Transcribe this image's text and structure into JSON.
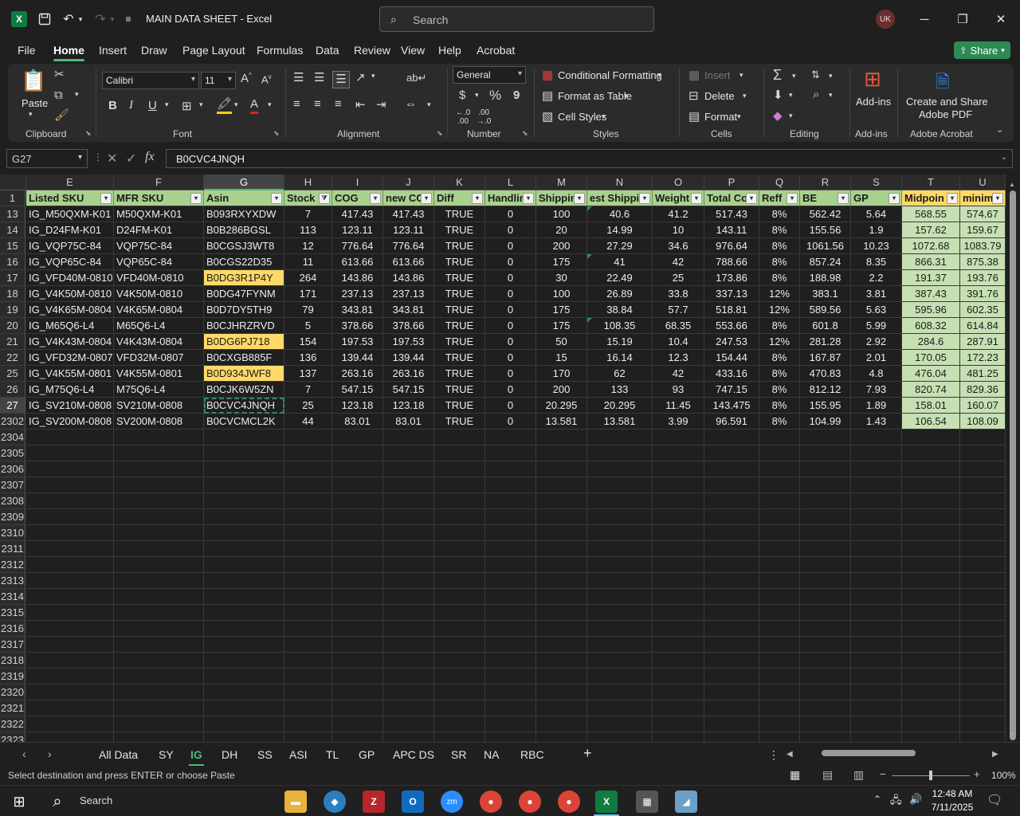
{
  "window": {
    "title": "MAIN DATA SHEET  -  Excel",
    "search_placeholder": "Search",
    "avatar_initials": "UK"
  },
  "ribbon_tabs": [
    "File",
    "Home",
    "Insert",
    "Draw",
    "Page Layout",
    "Formulas",
    "Data",
    "Review",
    "View",
    "Help",
    "Acrobat"
  ],
  "active_ribbon_tab": "Home",
  "share_label": "Share",
  "ribbon": {
    "clipboard": {
      "label": "Clipboard",
      "paste": "Paste"
    },
    "font": {
      "label": "Font",
      "name": "Calibri",
      "size": "11",
      "bold": "B",
      "italic": "I",
      "underline": "U"
    },
    "alignment": {
      "label": "Alignment"
    },
    "number": {
      "label": "Number",
      "format": "General",
      "currency": "$",
      "percent": "%",
      "comma": "9"
    },
    "styles": {
      "label": "Styles",
      "conditional": "Conditional Formatting",
      "format_table": "Format as Table",
      "cell_styles": "Cell Styles"
    },
    "cells": {
      "label": "Cells",
      "insert": "Insert",
      "delete": "Delete",
      "format": "Format"
    },
    "editing": {
      "label": "Editing"
    },
    "addins": {
      "label": "Add-ins",
      "button": "Add-ins"
    },
    "acrobat": {
      "label": "Adobe Acrobat",
      "button_line1": "Create and Share",
      "button_line2": "Adobe PDF"
    }
  },
  "formula_bar": {
    "name_box": "G27",
    "fx": "fx",
    "value": "B0CVC4JNQH"
  },
  "grid": {
    "columns": [
      "E",
      "F",
      "G",
      "H",
      "I",
      "J",
      "K",
      "L",
      "M",
      "N",
      "O",
      "P",
      "Q",
      "R",
      "S",
      "T",
      "U"
    ],
    "selected_column": "G",
    "headers": [
      "Listed SKU",
      "MFR SKU",
      "Asin",
      "Stock",
      "COG",
      "new CC",
      "Diff",
      "Handlin",
      "Shippin",
      "est Shippi",
      "Weight",
      "Total Co",
      "Reff",
      "BE",
      "GP",
      "Midpoin",
      "minimu"
    ],
    "rows": [
      {
        "n": "13",
        "cells": [
          "IG_M50QXM-K01",
          "M50QXM-K01",
          "B093RXYXDW",
          "7",
          "417.43",
          "417.43",
          "TRUE",
          "0",
          "100",
          "40.6",
          "41.2",
          "517.43",
          "8%",
          "562.42",
          "5.64",
          "568.55",
          "574.67"
        ],
        "asin_hl": false
      },
      {
        "n": "14",
        "cells": [
          "IG_D24FM-K01",
          "D24FM-K01",
          "B0B286BGSL",
          "113",
          "123.11",
          "123.11",
          "TRUE",
          "0",
          "20",
          "14.99",
          "10",
          "143.11",
          "8%",
          "155.56",
          "1.9",
          "157.62",
          "159.67"
        ],
        "asin_hl": false
      },
      {
        "n": "15",
        "cells": [
          "IG_VQP75C-84",
          "VQP75C-84",
          "B0CGSJ3WT8",
          "12",
          "776.64",
          "776.64",
          "TRUE",
          "0",
          "200",
          "27.29",
          "34.6",
          "976.64",
          "8%",
          "1061.56",
          "10.23",
          "1072.68",
          "1083.79"
        ],
        "asin_hl": false
      },
      {
        "n": "16",
        "cells": [
          "IG_VQP65C-84",
          "VQP65C-84",
          "B0CGS22D35",
          "11",
          "613.66",
          "613.66",
          "TRUE",
          "0",
          "175",
          "41",
          "42",
          "788.66",
          "8%",
          "857.24",
          "8.35",
          "866.31",
          "875.38"
        ],
        "asin_hl": false
      },
      {
        "n": "17",
        "cells": [
          "IG_VFD40M-0810",
          "VFD40M-0810",
          "B0DG3R1P4Y",
          "264",
          "143.86",
          "143.86",
          "TRUE",
          "0",
          "30",
          "22.49",
          "25",
          "173.86",
          "8%",
          "188.98",
          "2.2",
          "191.37",
          "193.76"
        ],
        "asin_hl": true
      },
      {
        "n": "18",
        "cells": [
          "IG_V4K50M-0810",
          "V4K50M-0810",
          "B0DG47FYNM",
          "171",
          "237.13",
          "237.13",
          "TRUE",
          "0",
          "100",
          "26.89",
          "33.8",
          "337.13",
          "12%",
          "383.1",
          "3.81",
          "387.43",
          "391.76"
        ],
        "asin_hl": false
      },
      {
        "n": "19",
        "cells": [
          "IG_V4K65M-0804",
          "V4K65M-0804",
          "B0D7DY5TH9",
          "79",
          "343.81",
          "343.81",
          "TRUE",
          "0",
          "175",
          "38.84",
          "57.7",
          "518.81",
          "12%",
          "589.56",
          "5.63",
          "595.96",
          "602.35"
        ],
        "asin_hl": false
      },
      {
        "n": "20",
        "cells": [
          "IG_M65Q6-L4",
          "M65Q6-L4",
          "B0CJHRZRVD",
          "5",
          "378.66",
          "378.66",
          "TRUE",
          "0",
          "175",
          "108.35",
          "68.35",
          "553.66",
          "8%",
          "601.8",
          "5.99",
          "608.32",
          "614.84"
        ],
        "asin_hl": false
      },
      {
        "n": "21",
        "cells": [
          "IG_V4K43M-0804",
          "V4K43M-0804",
          "B0DG6PJ718",
          "154",
          "197.53",
          "197.53",
          "TRUE",
          "0",
          "50",
          "15.19",
          "10.4",
          "247.53",
          "12%",
          "281.28",
          "2.92",
          "284.6",
          "287.91"
        ],
        "asin_hl": true
      },
      {
        "n": "22",
        "cells": [
          "IG_VFD32M-0807",
          "VFD32M-0807",
          "B0CXGB885F",
          "136",
          "139.44",
          "139.44",
          "TRUE",
          "0",
          "15",
          "16.14",
          "12.3",
          "154.44",
          "8%",
          "167.87",
          "2.01",
          "170.05",
          "172.23"
        ],
        "asin_hl": false
      },
      {
        "n": "25",
        "cells": [
          "IG_V4K55M-0801",
          "V4K55M-0801",
          "B0D934JWF8",
          "137",
          "263.16",
          "263.16",
          "TRUE",
          "0",
          "170",
          "62",
          "42",
          "433.16",
          "8%",
          "470.83",
          "4.8",
          "476.04",
          "481.25"
        ],
        "asin_hl": true
      },
      {
        "n": "26",
        "cells": [
          "IG_M75Q6-L4",
          "M75Q6-L4",
          "B0CJK6W5ZN",
          "7",
          "547.15",
          "547.15",
          "TRUE",
          "0",
          "200",
          "133",
          "93",
          "747.15",
          "8%",
          "812.12",
          "7.93",
          "820.74",
          "829.36"
        ],
        "asin_hl": false
      },
      {
        "n": "27",
        "cells": [
          "IG_SV210M-0808",
          "SV210M-0808",
          "B0CVC4JNQH",
          "25",
          "123.18",
          "123.18",
          "TRUE",
          "0",
          "20.295",
          "20.295",
          "11.45",
          "143.475",
          "8%",
          "155.95",
          "1.89",
          "158.01",
          "160.07"
        ],
        "asin_hl": false
      },
      {
        "n": "2302",
        "cells": [
          "IG_SV200M-0808",
          "SV200M-0808",
          "B0CVCMCL2K",
          "44",
          "83.01",
          "83.01",
          "TRUE",
          "0",
          "13.581",
          "13.581",
          "3.99",
          "96.591",
          "8%",
          "104.99",
          "1.43",
          "106.54",
          "108.09"
        ],
        "asin_hl": false
      }
    ],
    "empty_rows": [
      "2304",
      "2305",
      "2306",
      "2307",
      "2308",
      "2309",
      "2310",
      "2311",
      "2312",
      "2313",
      "2314",
      "2315",
      "2316",
      "2317",
      "2318",
      "2319",
      "2320",
      "2321",
      "2322",
      "2323"
    ]
  },
  "sheet_tabs": [
    "All Data",
    "SY",
    "IG",
    "DH",
    "SS",
    "ASI",
    "TL",
    "GP",
    "APC DS",
    "SR",
    "NA",
    "RBC"
  ],
  "active_sheet": "IG",
  "status": {
    "text": "Select destination and press ENTER or choose Paste",
    "zoom": "100%"
  },
  "taskbar": {
    "search": "Search",
    "time": "12:48 AM",
    "date": "7/11/2025"
  },
  "colors": {
    "header_green": "#a9d18e",
    "highlight_yellow": "#ffd966",
    "midpoint_green": "#c6e0b4",
    "accent": "#4fb87a"
  }
}
